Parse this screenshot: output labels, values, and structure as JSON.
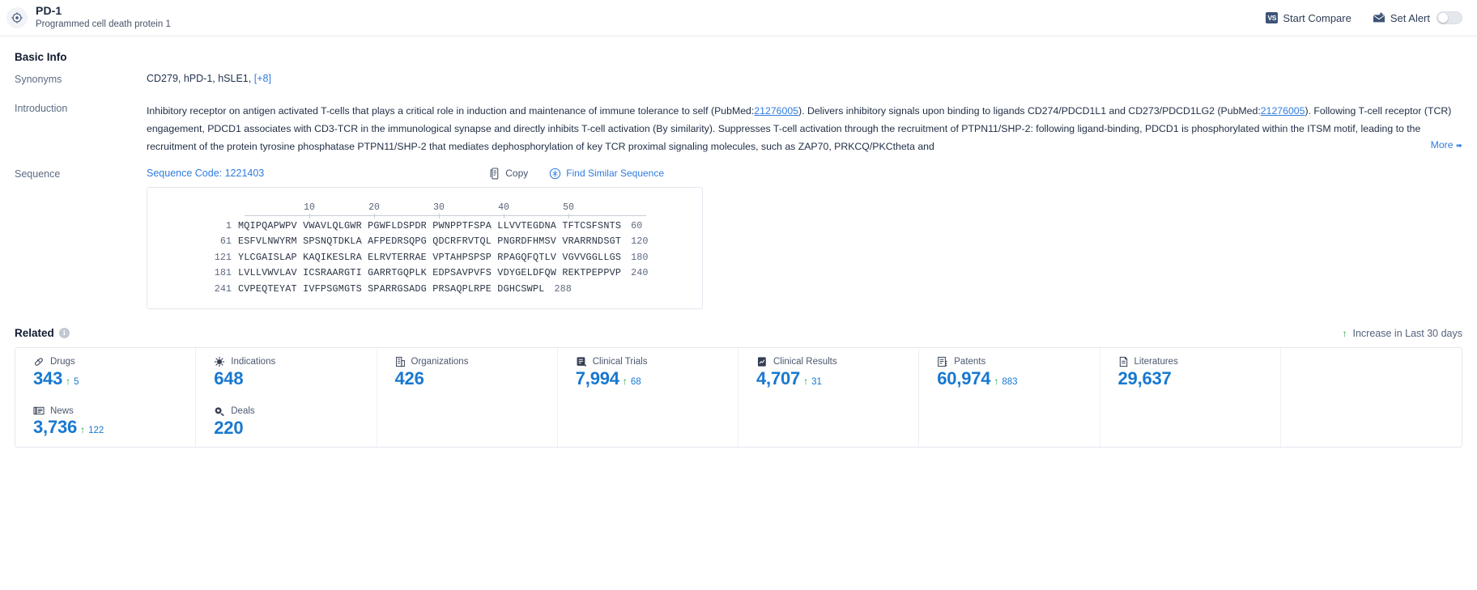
{
  "header": {
    "title": "PD-1",
    "subtitle": "Programmed cell death protein 1",
    "target_icon": "target-icon",
    "start_compare_label": "Start Compare",
    "vs_badge": "VS",
    "set_alert_label": "Set Alert",
    "alert_toggle_state": "off"
  },
  "basic_info": {
    "section_title": "Basic Info",
    "synonyms": {
      "label": "Synonyms",
      "value": "CD279, hPD-1, hSLE1,",
      "more_label": "[+8]"
    },
    "introduction": {
      "label": "Introduction",
      "part1": "Inhibitory receptor on antigen activated T-cells that plays a critical role in induction and maintenance of immune tolerance to self (PubMed:",
      "pubmed1": "21276005",
      "part2": "). Delivers inhibitory signals upon binding to ligands CD274/PDCD1L1 and CD273/PDCD1LG2 (PubMed:",
      "pubmed2": "21276005",
      "part3": "). Following T-cell receptor (TCR) engagement, PDCD1 associates with CD3-TCR in the immunological synapse and directly inhibits T-cell activation (By similarity). Suppresses T-cell activation through the recruitment of PTPN11/SHP-2: following ligand-binding, PDCD1 is phosphorylated within the ITSM motif, leading to the recruitment of the protein tyrosine phosphatase PTPN11/SHP-2 that mediates dephosphorylation of key TCR proximal signaling molecules, such as ZAP70, PRKCQ/PKCtheta and",
      "more_label": "More"
    }
  },
  "sequence": {
    "label": "Sequence",
    "code_label": "Sequence Code: 1221403",
    "copy_label": "Copy",
    "find_similar_label": "Find Similar Sequence",
    "ruler_ticks": [
      10,
      20,
      30,
      40,
      50
    ],
    "rows": [
      {
        "start": "1",
        "residues": "MQIPQAPWPV VWAVLQLGWR PGWFLDSPDR PWNPPTFSPA LLVVTEGDNA TFTCSFSNTS",
        "end": "60"
      },
      {
        "start": "61",
        "residues": "ESFVLNWYRM SPSNQTDKLA AFPEDRSQPG QDCRFRVTQL PNGRDFHMSV VRARRNDSGT",
        "end": "120"
      },
      {
        "start": "121",
        "residues": "YLCGAISLAP KAQIKESLRA ELRVTERRAE VPTAHPSPSP RPAGQFQTLV VGVVGGLLGS",
        "end": "180"
      },
      {
        "start": "181",
        "residues": "LVLLVWVLAV ICSRAARGTI GARRTGQPLK EDPSAVPVFS VDYGELDFQW REKTPEPPVP",
        "end": "240"
      },
      {
        "start": "241",
        "residues": "CVPEQTEYAT IVFPSGMGTS SPARRGSADG PRSAQPLRPE DGHCSWPL",
        "end": "288"
      }
    ]
  },
  "related": {
    "title": "Related",
    "info_icon": "info-icon",
    "legend_label": "Increase in Last 30 days",
    "legend_arrow": "↑",
    "accent_color": "#1878d0",
    "increase_color": "#22a044",
    "cards": [
      {
        "icon": "capsule-icon",
        "label": "Drugs",
        "value": "343",
        "delta": "5"
      },
      {
        "icon": "virus-icon",
        "label": "Indications",
        "value": "648",
        "delta": ""
      },
      {
        "icon": "building-icon",
        "label": "Organizations",
        "value": "426",
        "delta": ""
      },
      {
        "icon": "clinical-trial-icon",
        "label": "Clinical Trials",
        "value": "7,994",
        "delta": "68"
      },
      {
        "icon": "clinical-result-icon",
        "label": "Clinical Results",
        "value": "4,707",
        "delta": "31"
      },
      {
        "icon": "patent-icon",
        "label": "Patents",
        "value": "60,974",
        "delta": "883"
      },
      {
        "icon": "literature-icon",
        "label": "Literatures",
        "value": "29,637",
        "delta": ""
      },
      {
        "icon": "news-icon",
        "label": "News",
        "value": "3,736",
        "delta": "122"
      },
      {
        "icon": "deal-icon",
        "label": "Deals",
        "value": "220",
        "delta": ""
      }
    ]
  }
}
